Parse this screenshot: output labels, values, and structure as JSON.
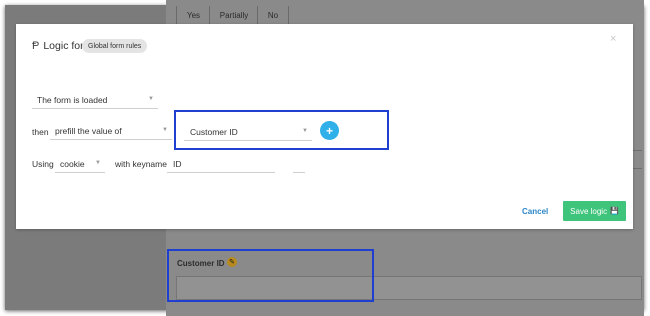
{
  "background": {
    "table_headers": [
      "Yes",
      "Partially",
      "No"
    ],
    "field_label": "Customer ID",
    "field_badge": "✎"
  },
  "modal": {
    "title": "Logic for",
    "title_icon": "Ᵽ",
    "scope_chip": "Global form rules",
    "close_icon": "×",
    "trigger_select": "The form is loaded",
    "then_label": "then",
    "action_select": "prefill the value of",
    "target_select": "Customer ID",
    "add_button_icon": "+",
    "using_label": "Using",
    "source_select": "cookie",
    "keyname_label": "with keyname",
    "keyname_value": "ID",
    "cancel_label": "Cancel",
    "save_label": "Save logic",
    "save_icon": "💾"
  },
  "colors": {
    "accent_blue": "#2fb0e8",
    "save_green": "#3fc47b",
    "highlight": "#1f3fd0"
  }
}
